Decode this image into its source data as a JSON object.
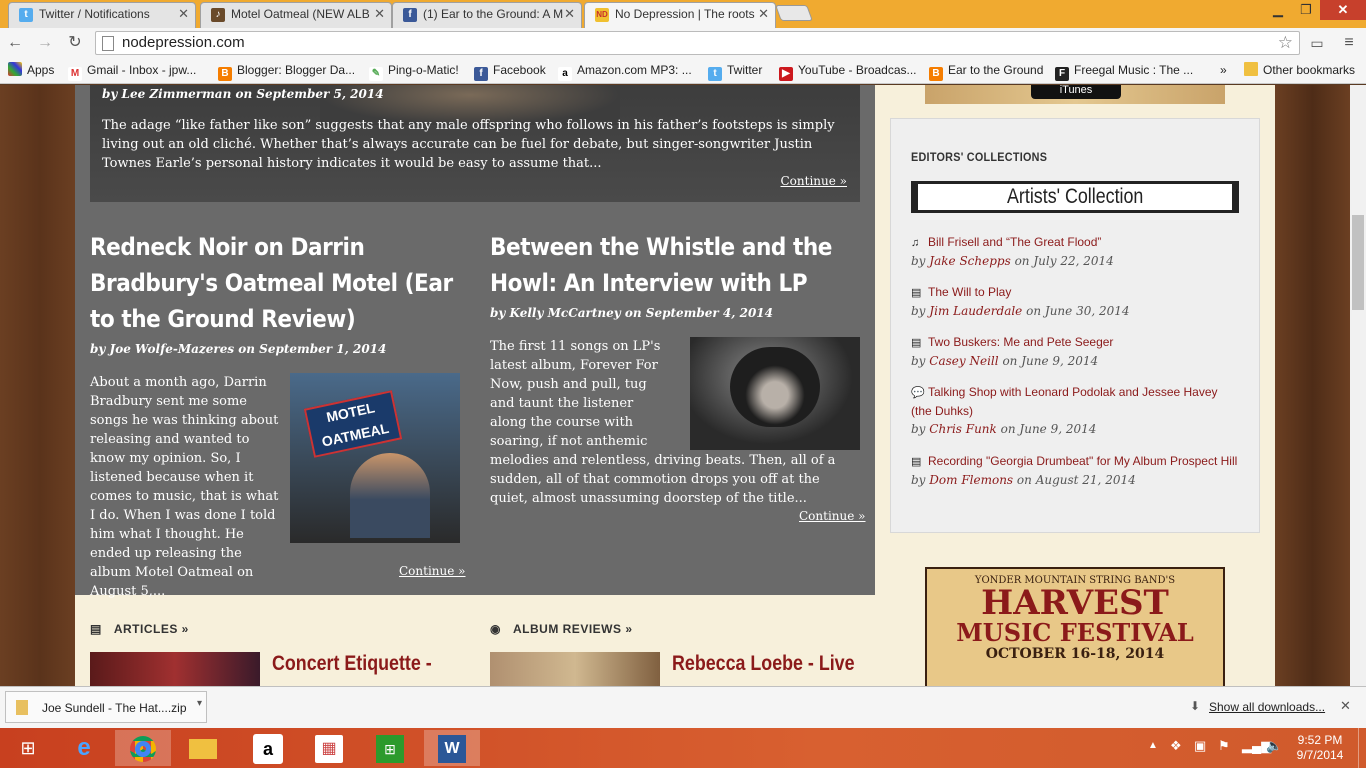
{
  "tabs": [
    {
      "label": "Twitter / Notifications",
      "icon": "twitter-icon",
      "color": "#55acee"
    },
    {
      "label": "Motel Oatmeal (NEW ALB",
      "icon": "album-icon",
      "color": "#6a4a2a"
    },
    {
      "label": "(1) Ear to the Ground: A M",
      "icon": "facebook-icon",
      "color": "#3b5998"
    },
    {
      "label": "No Depression | The roots",
      "icon": "nd-icon",
      "color": "#c9302c"
    }
  ],
  "address": "nodepression.com",
  "bookmarks": [
    "Apps",
    "Gmail - Inbox - jpw...",
    "Blogger: Blogger Da...",
    "Ping-o-Matic!",
    "Facebook",
    "Amazon.com MP3: ...",
    "Twitter",
    "YouTube - Broadcas...",
    "Ear to the Ground",
    "Freegal Music : The ...",
    "»",
    "Other bookmarks"
  ],
  "featured": {
    "byline": "by Lee Zimmerman on September 5, 2014",
    "excerpt": "The adage “like father like son” suggests that any male offspring who follows in his father’s footsteps is simply living out an old cliché. Whether that’s always accurate can be fuel for debate, but singer-songwriter Justin Townes Earle’s personal history indicates it would be easy to assume that...",
    "continue": "Continue »"
  },
  "article1": {
    "title": "Redneck Noir on Darrin Bradbury's Oatmeal Motel (Ear to the Ground Review)",
    "byline": "by Joe Wolfe-Mazeres on September 1, 2014",
    "excerpt": "About a month ago, Darrin Bradbury sent me some songs he was thinking about releasing and wanted to know my opinion.  So, I listened because when it comes to music, that is what I do. When I was done I told him what I thought. He ended up releasing the album Motel Oatmeal on August 5,...",
    "continue": "Continue »",
    "image_text": "MOTEL OATMEAL"
  },
  "article2": {
    "title": "Between the Whistle and the Howl: An Interview with LP",
    "byline": "by Kelly McCartney on September 4, 2014",
    "excerpt": "The first 11 songs on LP's latest album, Forever For Now, push and pull, tug and taunt the listener along the course with soaring, if not anthemic melodies and relentless, driving beats. Then, all of a sudden, all of that commotion drops you off at the quiet, almost unassuming doorstep of the title...",
    "continue": "Continue »"
  },
  "sections": [
    {
      "label": "ARTICLES »",
      "title": "Concert Etiquette -"
    },
    {
      "label": "ALBUM REVIEWS »",
      "title": "Rebecca Loebe - Live"
    }
  ],
  "sidebar": {
    "heading": "EDITORS' COLLECTIONS",
    "collection": "Artists' Collection",
    "items": [
      {
        "icon": "music-note-icon",
        "title": "Bill Frisell and “The Great Flood”",
        "by": "by",
        "author": "Jake Schepps",
        "date": "on July 22, 2014"
      },
      {
        "icon": "book-icon",
        "title": "The Will to Play",
        "by": "by",
        "author": "Jim Lauderdale",
        "date": "on June 30, 2014"
      },
      {
        "icon": "book-icon",
        "title": "Two Buskers: Me and Pete Seeger",
        "by": "by",
        "author": "Casey Neill",
        "date": "on June 9, 2014"
      },
      {
        "icon": "chat-icon",
        "title": "Talking Shop with Leonard Podolak and Jessee Havey (the Duhks)",
        "by": "by",
        "author": "Chris Funk",
        "date": "on June 9, 2014"
      },
      {
        "icon": "book-icon",
        "title": "Recording \"Georgia Drumbeat\" for My Album Prospect Hill",
        "by": "by",
        "author": "Dom Flemons",
        "date": "on August 21, 2014"
      }
    ],
    "ad_top": "iTunes",
    "ad_harvest": {
      "line1": "YONDER MOUNTAIN STRING BAND'S",
      "line2": "HARVEST",
      "line3": "MUSIC FESTIVAL",
      "line4": "OCTOBER 16-18, 2014"
    }
  },
  "download": {
    "file": "Joe Sundell - The Hat....zip",
    "show_all": "Show all downloads..."
  },
  "clock": {
    "time": "9:52 PM",
    "date": "9/7/2014"
  }
}
